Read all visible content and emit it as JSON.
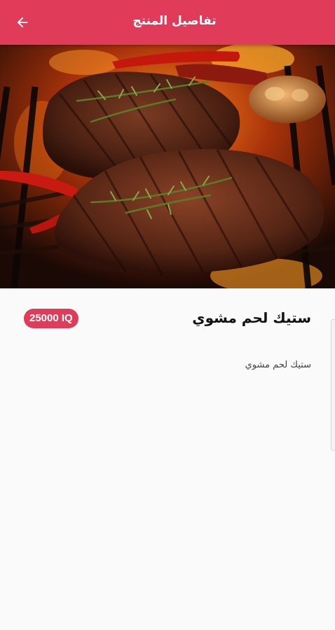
{
  "header": {
    "title": "تفاصيل المنتج",
    "back_icon": "arrow-left-icon",
    "background_color": "#e03c5a"
  },
  "product": {
    "image_description_icon": "grilled-steak-photo",
    "name": "ستيك لحم مشوي",
    "price": "25000 IQ",
    "description": "ستيك لحم مشوي",
    "price_badge_color": "#e03c5a"
  }
}
